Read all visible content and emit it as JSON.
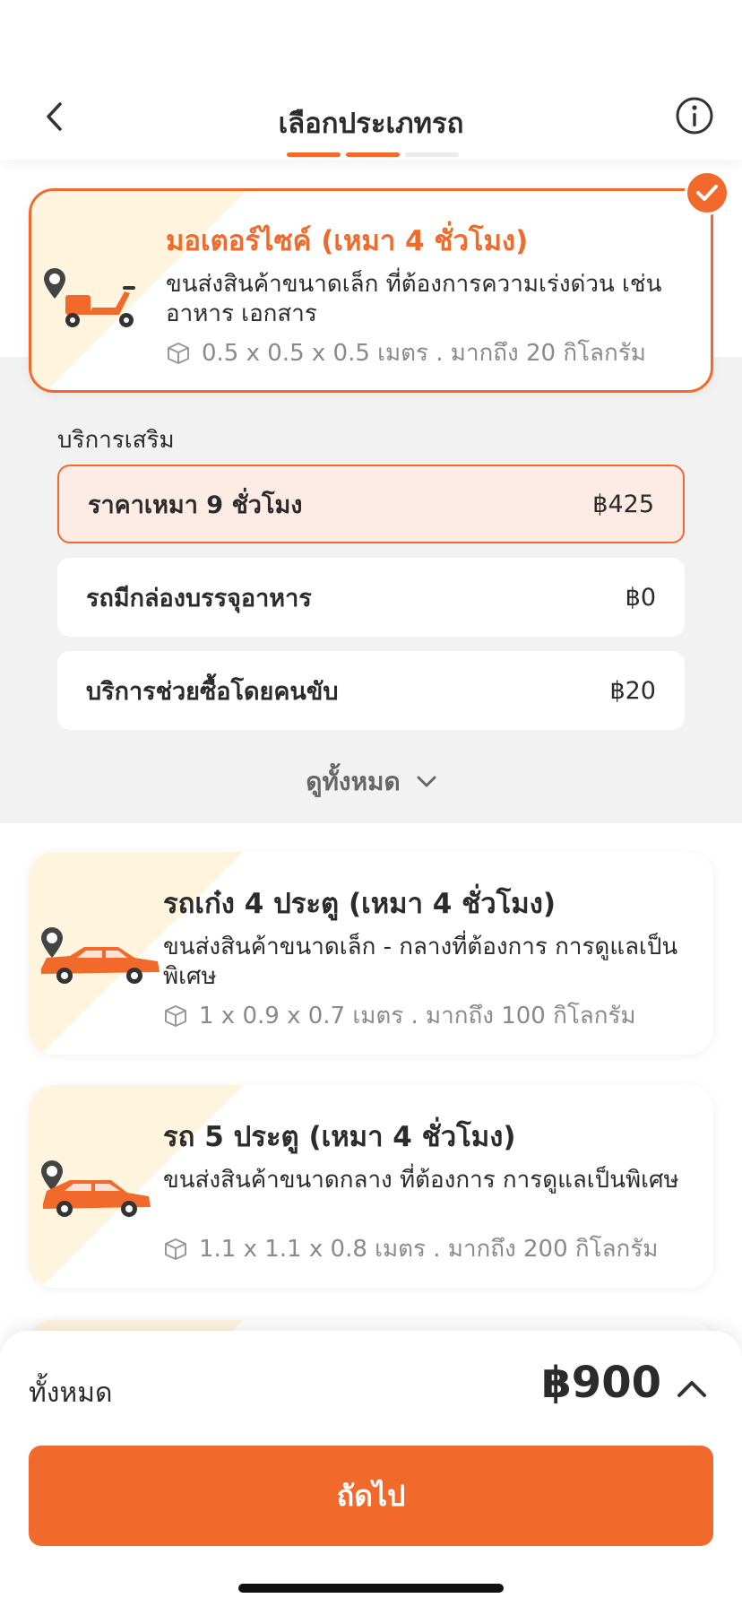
{
  "header": {
    "title": "เลือกประเภทรถ"
  },
  "selected_vehicle": {
    "title": "มอเตอร์ไซค์ (เหมา 4 ชั่วโมง)",
    "desc": "ขนส่งสินค้าขนาดเล็ก ที่ต้องการความเร่งด่วน เช่น อาหาร เอกสาร",
    "dims": "0.5 x 0.5 x 0.5 เมตร . มากถึง 20 กิโลกรัม"
  },
  "extras": {
    "label": "บริการเสริม",
    "items": [
      {
        "label": "ราคาเหมา 9 ชั่วโมง",
        "price": "฿425"
      },
      {
        "label": "รถมีกล่องบรรจุอาหาร",
        "price": "฿0"
      },
      {
        "label": "บริการช่วยซื้อโดยคนขับ",
        "price": "฿20"
      }
    ],
    "see_all": "ดูทั้งหมด"
  },
  "vehicles": [
    {
      "title": "รถเก๋ง 4 ประตู (เหมา 4 ชั่วโมง)",
      "desc": "ขนส่งสินค้าขนาดเล็ก - กลางที่ต้องการ การดูแลเป็นพิเศษ",
      "dims": "1 x 0.9 x 0.7 เมตร . มากถึง 100 กิโลกรัม"
    },
    {
      "title": "รถ 5 ประตู (เหมา 4 ชั่วโมง)",
      "desc": "ขนส่งสินค้าขนาดกลาง ที่ต้องการ การดูแลเป็นพิเศษ",
      "dims": "1.1 x 1.1 x 0.8 เมตร . มากถึง 200 กิโลกรัม"
    }
  ],
  "footer": {
    "total_label": "ทั้งหมด",
    "total_value": "฿900",
    "next_label": "ถัดไป"
  },
  "colors": {
    "accent": "#f26a2b",
    "highlight_bg": "#fdece5",
    "wedge": "#fff5df"
  }
}
